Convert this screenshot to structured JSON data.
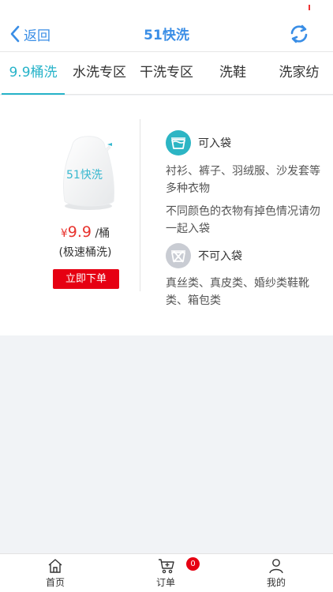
{
  "header": {
    "back_label": "返回",
    "title": "51快洗"
  },
  "tabs": [
    {
      "label": "9.9桶洗"
    },
    {
      "label": "水洗专区"
    },
    {
      "label": "干洗专区"
    },
    {
      "label": "洗鞋"
    },
    {
      "label": "洗家纺"
    }
  ],
  "product": {
    "bag_label": "51快洗",
    "currency": "¥",
    "price": "9.9",
    "unit": "/桶",
    "subtitle": "(极速桶洗)",
    "order_button": "立即下单"
  },
  "allowed": {
    "title": "可入袋",
    "line1": "衬衫、裤子、羽绒服、沙发套等多种衣物",
    "line2": "不同颜色的衣物有掉色情况请勿一起入袋"
  },
  "not_allowed": {
    "title": "不可入袋",
    "line1": "真丝类、真皮类、婚纱类鞋靴类、箱包类"
  },
  "bottom_nav": [
    {
      "label": "首页",
      "icon": "home-icon"
    },
    {
      "label": "订单",
      "icon": "cart-icon"
    },
    {
      "label": "我的",
      "icon": "user-icon"
    }
  ],
  "cart_badge": "0",
  "colors": {
    "accent": "#27b3c9",
    "header_blue": "#3a8ee6",
    "price_red": "#e8332e",
    "button_red": "#e60012"
  }
}
